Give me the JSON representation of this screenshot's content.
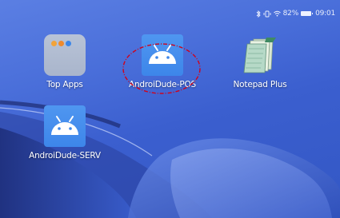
{
  "status_bar": {
    "battery_percent": "82%",
    "time": "09:01",
    "icons": [
      "bluetooth-icon",
      "vibrate-icon",
      "wifi-icon",
      "battery-icon"
    ]
  },
  "apps": [
    {
      "label": "Top Apps",
      "icon": "folder-icon"
    },
    {
      "label": "AndroiDude-POS",
      "icon": "android-head-icon"
    },
    {
      "label": "Notepad Plus",
      "icon": "notepad-icon"
    },
    {
      "label": "AndroiDude-SERV",
      "icon": "android-head-icon"
    }
  ],
  "colors": {
    "wallpaper": "#4a6fda",
    "android_tile": "#4a8fee",
    "annotation": "#d0021b"
  }
}
